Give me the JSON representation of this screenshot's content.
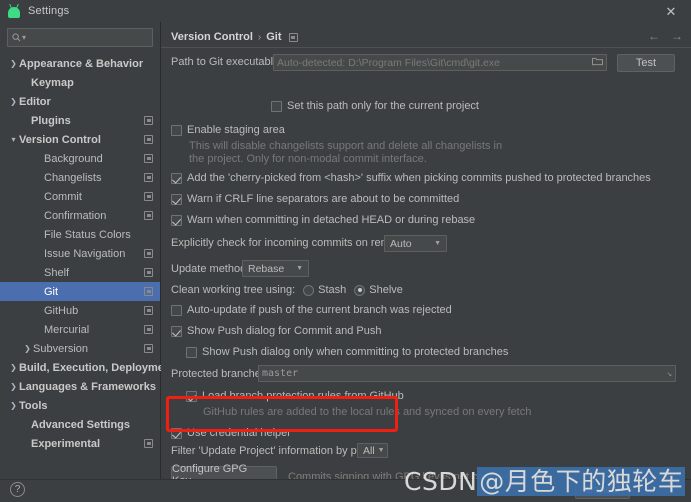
{
  "window": {
    "title": "Settings",
    "app_icon": "android-robot-icon",
    "close_icon": "close-icon"
  },
  "sidebar": {
    "search": {
      "placeholder": "",
      "value": "",
      "icon": "search-icon"
    },
    "items": [
      {
        "label": "Appearance & Behavior",
        "arrow": "collapsed",
        "bold": true,
        "badge": false,
        "indent": 8,
        "selected": false
      },
      {
        "label": "Keymap",
        "arrow": "none",
        "bold": true,
        "badge": false,
        "indent": 20,
        "selected": false
      },
      {
        "label": "Editor",
        "arrow": "collapsed",
        "bold": true,
        "badge": false,
        "indent": 8,
        "selected": false
      },
      {
        "label": "Plugins",
        "arrow": "none",
        "bold": true,
        "badge": true,
        "indent": 20,
        "selected": false
      },
      {
        "label": "Version Control",
        "arrow": "expanded",
        "bold": true,
        "badge": true,
        "indent": 8,
        "selected": false
      },
      {
        "label": "Background",
        "arrow": "none",
        "bold": false,
        "badge": true,
        "indent": 33,
        "selected": false
      },
      {
        "label": "Changelists",
        "arrow": "none",
        "bold": false,
        "badge": true,
        "indent": 33,
        "selected": false
      },
      {
        "label": "Commit",
        "arrow": "none",
        "bold": false,
        "badge": true,
        "indent": 33,
        "selected": false
      },
      {
        "label": "Confirmation",
        "arrow": "none",
        "bold": false,
        "badge": true,
        "indent": 33,
        "selected": false
      },
      {
        "label": "File Status Colors",
        "arrow": "none",
        "bold": false,
        "badge": false,
        "indent": 33,
        "selected": false
      },
      {
        "label": "Issue Navigation",
        "arrow": "none",
        "bold": false,
        "badge": true,
        "indent": 33,
        "selected": false
      },
      {
        "label": "Shelf",
        "arrow": "none",
        "bold": false,
        "badge": true,
        "indent": 33,
        "selected": false
      },
      {
        "label": "Git",
        "arrow": "none",
        "bold": false,
        "badge": true,
        "indent": 33,
        "selected": true
      },
      {
        "label": "GitHub",
        "arrow": "none",
        "bold": false,
        "badge": true,
        "indent": 33,
        "selected": false
      },
      {
        "label": "Mercurial",
        "arrow": "none",
        "bold": false,
        "badge": true,
        "indent": 33,
        "selected": false
      },
      {
        "label": "Subversion",
        "arrow": "collapsed",
        "bold": false,
        "badge": true,
        "indent": 22,
        "selected": false
      },
      {
        "label": "Build, Execution, Deployment",
        "arrow": "collapsed",
        "bold": true,
        "badge": false,
        "indent": 8,
        "selected": false
      },
      {
        "label": "Languages & Frameworks",
        "arrow": "collapsed",
        "bold": true,
        "badge": false,
        "indent": 8,
        "selected": false
      },
      {
        "label": "Tools",
        "arrow": "collapsed",
        "bold": true,
        "badge": false,
        "indent": 8,
        "selected": false
      },
      {
        "label": "Advanced Settings",
        "arrow": "none",
        "bold": true,
        "badge": false,
        "indent": 20,
        "selected": false
      },
      {
        "label": "Experimental",
        "arrow": "none",
        "bold": true,
        "badge": true,
        "indent": 20,
        "selected": false
      }
    ]
  },
  "main": {
    "breadcrumb": {
      "root": "Version Control",
      "separator": "›",
      "leaf": "Git",
      "badge_icon": "project-scope-icon"
    },
    "nav": {
      "back_icon": "arrow-left-icon",
      "forward_icon": "arrow-right-icon"
    },
    "git_path": {
      "label": "Path to Git executable:",
      "value": "Auto-detected: D:\\Program Files\\Git\\cmd\\git.exe",
      "browse_icon": "folder-icon",
      "test_button": "Test"
    },
    "set_path_only": {
      "label": "Set this path only for the current project",
      "checked": false
    },
    "enable_staging": {
      "label": "Enable staging area",
      "checked": false,
      "hint_line1": "This will disable changelists support and delete all changelists in",
      "hint_line2": "the project. Only for non-modal commit interface."
    },
    "cherry_picked": {
      "label": "Add the 'cherry-picked from <hash>' suffix when picking commits pushed to protected branches",
      "checked": true
    },
    "warn_crlf": {
      "label": "Warn if CRLF line separators are about to be committed",
      "checked": true
    },
    "warn_detached": {
      "label": "Warn when committing in detached HEAD or during rebase",
      "checked": true
    },
    "incoming_commits": {
      "label": "Explicitly check for incoming commits on remotes:",
      "value": "Auto"
    },
    "update_method": {
      "label": "Update method:",
      "value": "Rebase"
    },
    "clean_tree": {
      "label": "Clean working tree using:",
      "option_stash": "Stash",
      "option_shelve": "Shelve",
      "selected": "Shelve"
    },
    "auto_update": {
      "label": "Auto-update if push of the current branch was rejected",
      "checked": false
    },
    "show_push_dialog": {
      "label": "Show Push dialog for Commit and Push",
      "checked": true
    },
    "show_push_protected": {
      "label": "Show Push dialog only when committing to protected branches",
      "checked": false
    },
    "protected_branches": {
      "label": "Protected branches:",
      "value": "master",
      "expand_icon": "expand-field-icon"
    },
    "load_branch_rules": {
      "label": "Load branch protection rules from GitHub",
      "checked": true,
      "hint": "GitHub rules are added to the local rules and synced on every fetch"
    },
    "use_credential_helper": {
      "label": "Use credential helper",
      "checked": true
    },
    "filter_paths": {
      "label": "Filter 'Update Project' information by paths:",
      "value": "All"
    },
    "gpg": {
      "button": "Configure GPG Key...",
      "status": "Commits signing with GPG key is not configured"
    }
  },
  "footer": {
    "help_icon": "?",
    "cancel_button": "Cancel"
  },
  "watermark": {
    "prefix": "CSDN",
    "handle": "@月色下的独轮车"
  },
  "colors": {
    "background": "#3c3f41",
    "selection": "#4b6eaf",
    "highlight_box": "#f01f12",
    "accent_green": "#3ddc84"
  }
}
